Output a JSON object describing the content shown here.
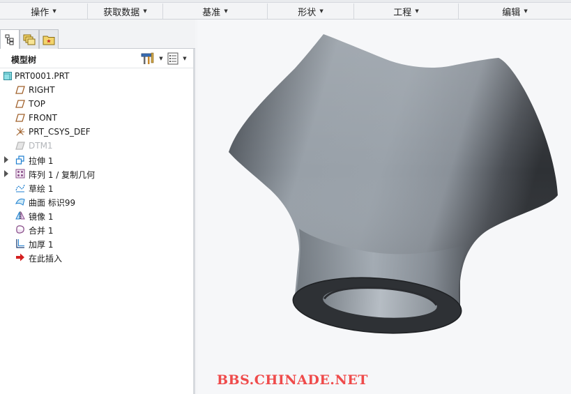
{
  "ribbon": {
    "groups": [
      {
        "label": "操作"
      },
      {
        "label": "获取数据"
      },
      {
        "label": "基准"
      },
      {
        "label": "形状"
      },
      {
        "label": "工程"
      },
      {
        "label": "编辑"
      }
    ]
  },
  "panel": {
    "tabs": [
      {
        "icon": "model-tree-tab-icon"
      },
      {
        "icon": "folder-browser-tab-icon"
      },
      {
        "icon": "favorites-tab-icon"
      }
    ],
    "title": "模型树",
    "tools": [
      {
        "icon": "settings-tools-icon"
      },
      {
        "icon": "show-options-icon"
      }
    ]
  },
  "tree": {
    "root": {
      "label": "PRT0001.PRT",
      "icon": "part-icon"
    },
    "items": [
      {
        "label": "RIGHT",
        "icon": "datum-plane-icon",
        "expandable": false,
        "dim": false
      },
      {
        "label": "TOP",
        "icon": "datum-plane-icon",
        "expandable": false,
        "dim": false
      },
      {
        "label": "FRONT",
        "icon": "datum-plane-icon",
        "expandable": false,
        "dim": false
      },
      {
        "label": "PRT_CSYS_DEF",
        "icon": "coordinate-system-icon",
        "expandable": false,
        "dim": false
      },
      {
        "label": "DTM1",
        "icon": "datum-plane-icon",
        "expandable": false,
        "dim": true
      },
      {
        "label": "拉伸 1",
        "icon": "extrude-icon",
        "expandable": true,
        "dim": false
      },
      {
        "label": "阵列 1 / 复制几何",
        "icon": "pattern-icon",
        "expandable": true,
        "dim": false
      },
      {
        "label": "草绘 1",
        "icon": "sketch-icon",
        "expandable": false,
        "dim": false
      },
      {
        "label": "曲面 标识99",
        "icon": "surface-icon",
        "expandable": false,
        "dim": false
      },
      {
        "label": "镜像 1",
        "icon": "mirror-icon",
        "expandable": false,
        "dim": false
      },
      {
        "label": "合并 1",
        "icon": "merge-icon",
        "expandable": false,
        "dim": false
      },
      {
        "label": "加厚 1",
        "icon": "thicken-icon",
        "expandable": false,
        "dim": false
      },
      {
        "label": "在此插入",
        "icon": "insert-here-icon",
        "expandable": false,
        "dim": false
      }
    ]
  },
  "viewport": {
    "watermark": "BBS.CHINADE.NET"
  },
  "colors": {
    "accent": "#1e7fd0",
    "datum": "#a0602a",
    "watermark": "#ef4b4b",
    "model_light": "#aab2ba",
    "model_dark": "#2c2f33"
  }
}
